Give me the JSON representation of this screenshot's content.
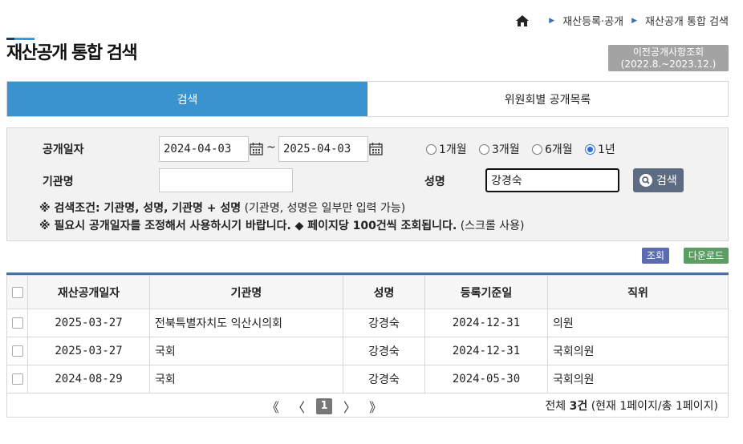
{
  "breadcrumb": {
    "items": [
      "재산등록·공개",
      "재산공개 통합 검색"
    ]
  },
  "page": {
    "title": "재산공개 통합 검색"
  },
  "prev_button": {
    "line1": "이전공개사항조회",
    "line2": "(2022.8.~2023.12.)"
  },
  "tabs": [
    {
      "label": "검색",
      "active": true
    },
    {
      "label": "위원회별 공개목록",
      "active": false
    }
  ],
  "search": {
    "date_label": "공개일자",
    "date_from": "2024-04-03",
    "date_to": "2025-04-03",
    "tilde": "~",
    "periods": [
      {
        "label": "1개월",
        "checked": false
      },
      {
        "label": "3개월",
        "checked": false
      },
      {
        "label": "6개월",
        "checked": false
      },
      {
        "label": "1년",
        "checked": true
      }
    ],
    "org_label": "기관명",
    "org_value": "",
    "name_label": "성명",
    "name_value": "강경숙",
    "search_button": "검색",
    "note1_bold": "※ 검색조건: 기관명, 성명, 기관명 + 성명",
    "note1_rest": " (기관명, 성명은 일부만 입력 가능)",
    "note2_bold": "※ 필요시 공개일자를 조정해서 사용하시기 바랍니다. ◆ 페이지당 100건씩 조회됩니다.",
    "note2_rest": " (스크롤 사용)"
  },
  "actions": {
    "view": "조회",
    "download": "다운로드"
  },
  "table": {
    "headers": [
      "재산공개일자",
      "기관명",
      "성명",
      "등록기준일",
      "직위"
    ],
    "rows": [
      [
        "2025-03-27",
        "전북특별자치도 익산시의회",
        "강경숙",
        "2024-12-31",
        "의원"
      ],
      [
        "2025-03-27",
        "국회",
        "강경숙",
        "2024-12-31",
        "국회의원"
      ],
      [
        "2024-08-29",
        "국회",
        "강경숙",
        "2024-05-30",
        "국회의원"
      ]
    ]
  },
  "pager": {
    "first": "《",
    "prev": "〈",
    "current": "1",
    "next": "〉",
    "last": "》",
    "total_prefix": "전체 ",
    "total_count": "3건",
    "total_suffix": " (현재 1페이지/총 1페이지)"
  }
}
